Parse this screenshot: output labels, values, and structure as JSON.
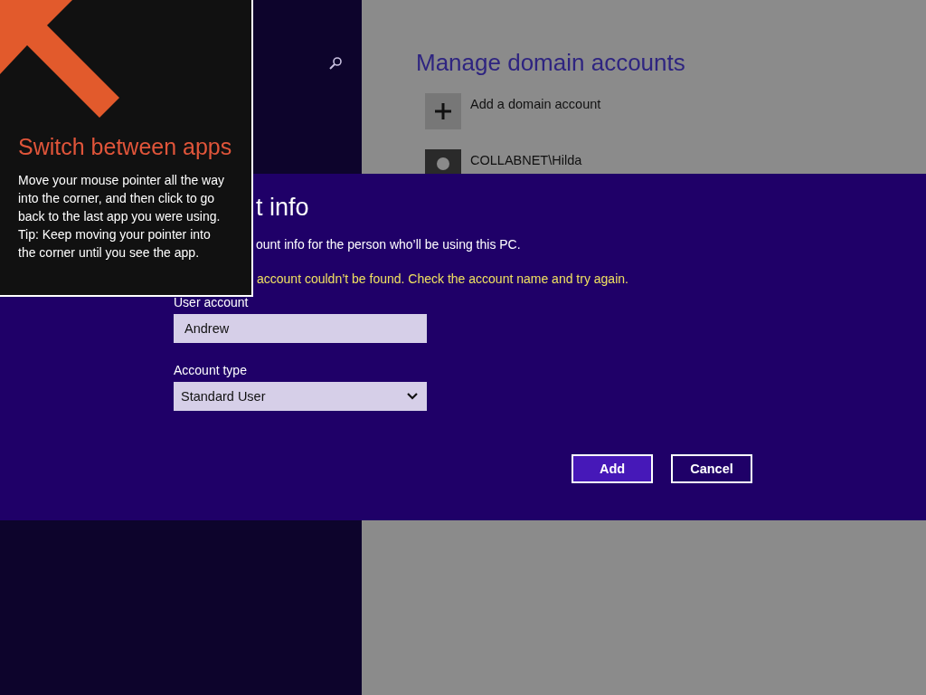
{
  "tip": {
    "title": "Switch between apps",
    "paragraphs": [
      "Move your mouse pointer all the way into the corner, and then click to go back to the last app you were using.",
      "Tip: Keep moving your pointer into the corner until you see the app."
    ]
  },
  "settings": {
    "title": "Manage domain accounts",
    "items": [
      {
        "kind": "add",
        "label": "Add a domain account"
      },
      {
        "kind": "user",
        "label": "COLLABNET\\Hilda"
      }
    ]
  },
  "dialog": {
    "title": "t info",
    "description": "ount info for the person who’ll be using this PC.",
    "error": "account couldn’t be found. Check the account name and try again.",
    "fields": [
      {
        "kind": "text",
        "label": "User account",
        "value": "Andrew"
      },
      {
        "kind": "select",
        "label": "Account type",
        "value": "Standard User"
      }
    ],
    "buttons": [
      {
        "label": "Add",
        "primary": true
      },
      {
        "label": "Cancel",
        "primary": false
      }
    ]
  }
}
